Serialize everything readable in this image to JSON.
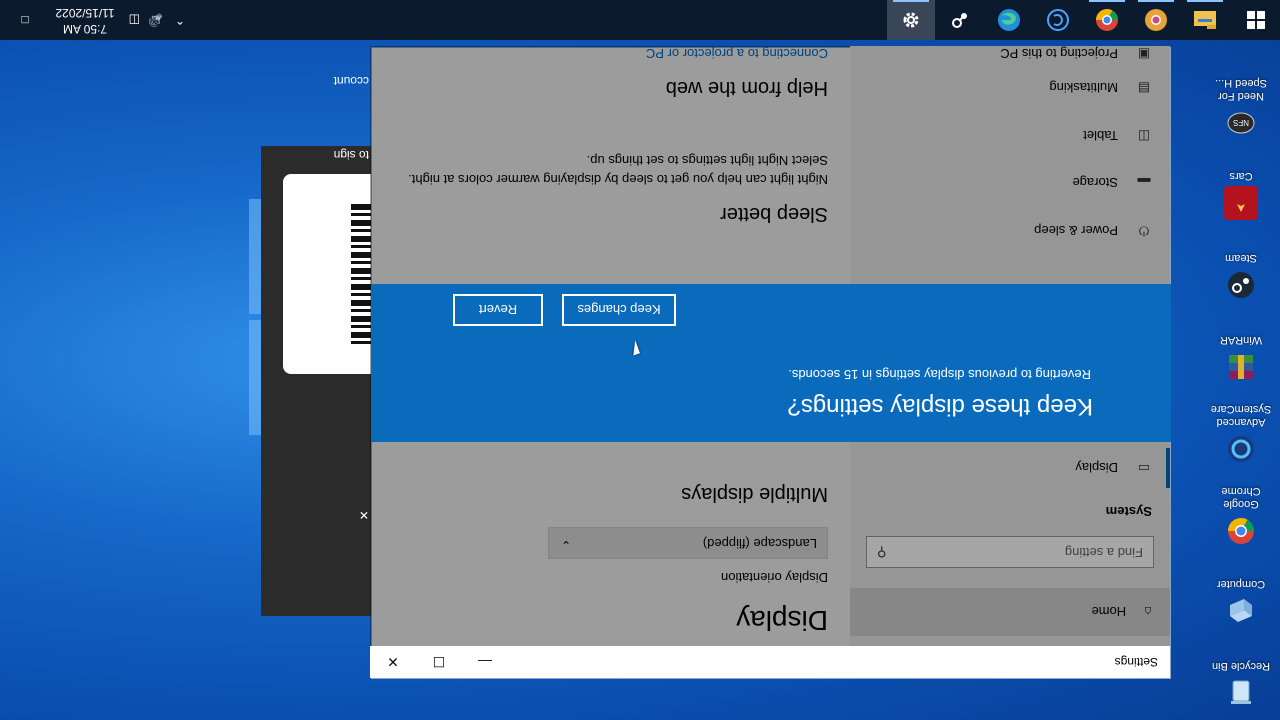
{
  "orientation": "landscape (flipped)",
  "desktop": {
    "icons": [
      {
        "label": "Recycle Bin",
        "icon": "recycle-bin-icon"
      },
      {
        "label": "Computer",
        "icon": "computer-icon"
      },
      {
        "label": "Google Chrome",
        "icon": "chrome-icon"
      },
      {
        "label": "Advanced SystemCare",
        "icon": "advanced-systemcare-icon"
      },
      {
        "label": "WinRAR",
        "icon": "winrar-icon"
      },
      {
        "label": "Steam",
        "icon": "steam-icon"
      },
      {
        "label": "Cars",
        "icon": "cars-game-icon"
      },
      {
        "label": "Need For Speed H...",
        "icon": "need-for-speed-icon"
      }
    ]
  },
  "background_window": {
    "text_sign": "to sign",
    "text_account": "ccount"
  },
  "settings": {
    "title": "Settings",
    "sidebar": {
      "home": "Home",
      "search_placeholder": "Find a setting",
      "section": "System",
      "items": [
        {
          "label": "Display",
          "icon": "monitor-icon"
        },
        {
          "label": "Power & sleep",
          "icon": "power-icon"
        },
        {
          "label": "Storage",
          "icon": "storage-icon"
        },
        {
          "label": "Tablet",
          "icon": "tablet-icon"
        },
        {
          "label": "Multitasking",
          "icon": "multitasking-icon"
        },
        {
          "label": "Projecting to this PC",
          "icon": "projecting-icon"
        }
      ]
    },
    "content": {
      "heading": "Display",
      "orientation_label": "Display orientation",
      "orientation_value": "Landscape (flipped)",
      "multiple_displays": "Multiple displays",
      "sleep_better": "Sleep better",
      "sleep_text": "Night light can help you get to sleep by displaying warmer colors at night. Select Night light settings to set things up.",
      "help_heading": "Help from the web",
      "help_link": "Connecting to a projector or PC"
    }
  },
  "dialog": {
    "title": "Keep these display settings?",
    "message": "Reverting to previous display settings in 15 seconds.",
    "keep_label": "Keep changes",
    "revert_label": "Revert"
  },
  "taskbar": {
    "time": "7:50 AM",
    "date": "11/15/2022",
    "apps": [
      "windows-start-icon",
      "file-explorer-icon",
      "chrome-canary-icon",
      "chrome-icon",
      "ccleaner-icon",
      "edge-icon",
      "steam-icon",
      "settings-gear-icon"
    ]
  },
  "colors": {
    "accent": "#0a6bbd",
    "taskbar": "#0c1a2e",
    "desktop": "#1668c9"
  }
}
